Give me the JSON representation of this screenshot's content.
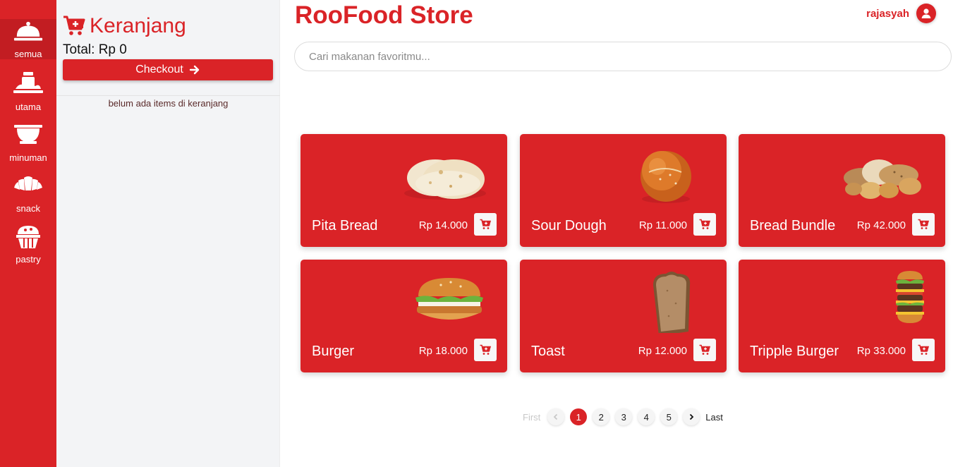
{
  "rail": {
    "items": [
      {
        "label": "semua",
        "icon": "cloche-icon"
      },
      {
        "label": "utama",
        "icon": "meal-icon"
      },
      {
        "label": "minuman",
        "icon": "drink-icon"
      },
      {
        "label": "snack",
        "icon": "croissant-icon"
      },
      {
        "label": "pastry",
        "icon": "cupcake-icon"
      }
    ],
    "active": "semua"
  },
  "cart": {
    "title": "Keranjang",
    "total": "Total: Rp 0",
    "checkout_label": "Checkout",
    "empty_message": "belum ada items di keranjang"
  },
  "header": {
    "brand": "RooFood Store",
    "username": "rajasyah"
  },
  "search": {
    "placeholder": "Cari makanan favoritmu...",
    "value": ""
  },
  "products": [
    {
      "name": "Pita Bread",
      "price": "Rp 14.000",
      "image": "pita-bread-image"
    },
    {
      "name": "Sour Dough",
      "price": "Rp 11.000",
      "image": "sour-dough-image"
    },
    {
      "name": "Bread Bundle",
      "price": "Rp 42.000",
      "image": "bread-bundle-image"
    },
    {
      "name": "Burger",
      "price": "Rp 18.000",
      "image": "burger-image"
    },
    {
      "name": "Toast",
      "price": "Rp 12.000",
      "image": "toast-image"
    },
    {
      "name": "Tripple Burger",
      "price": "Rp 33.000",
      "image": "tripple-burger-image"
    }
  ],
  "pagination": {
    "first": "First",
    "last": "Last",
    "pages": [
      "1",
      "2",
      "3",
      "4",
      "5"
    ],
    "current": "1"
  },
  "colors": {
    "brand": "#da2327",
    "panel": "#f3f4f6"
  }
}
